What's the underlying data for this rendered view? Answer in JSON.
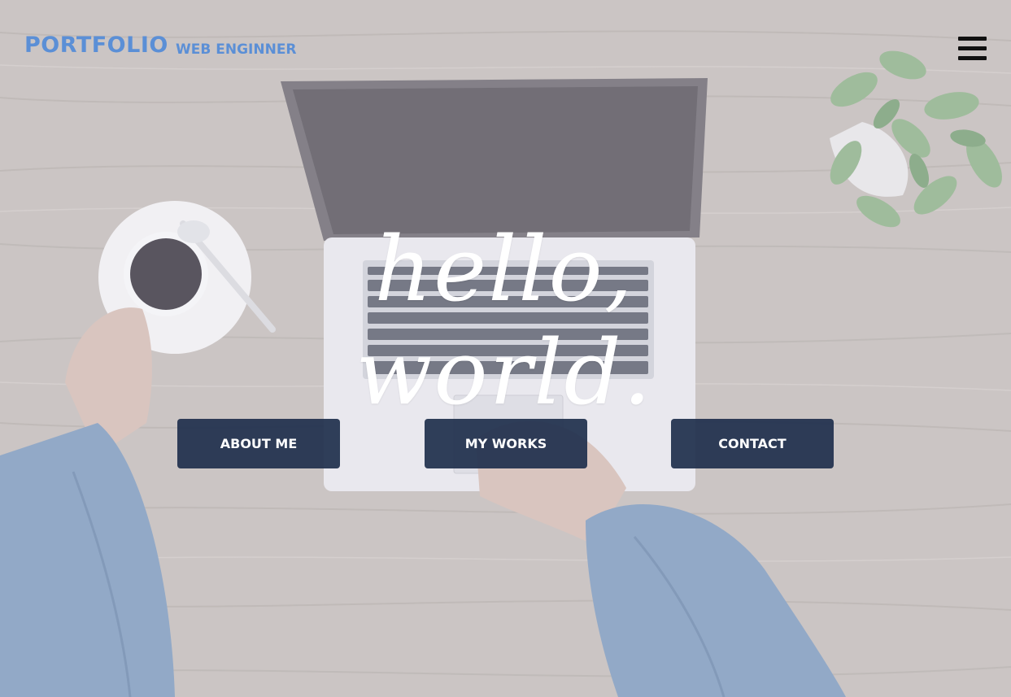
{
  "header": {
    "brand": "PORTFOLIO",
    "tagline": "WEB ENGINNER",
    "menu_icon": "hamburger-icon"
  },
  "hero": {
    "title": "hello, world."
  },
  "nav_buttons": [
    {
      "label": "ABOUT ME"
    },
    {
      "label": "MY WORKS"
    },
    {
      "label": "CONTACT"
    }
  ],
  "background": {
    "scene": "desk-with-laptop-coffee-plant",
    "overlay_color": "#ebe8ec"
  },
  "colors": {
    "brand": "#5b8fd6",
    "button_bg": "#20304e",
    "button_text": "#ffffff",
    "hero_text": "#ffffff"
  }
}
